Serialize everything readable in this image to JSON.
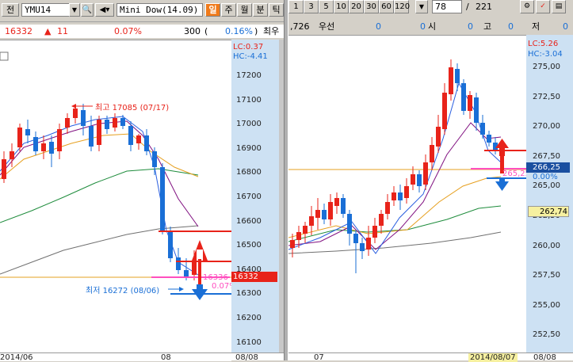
{
  "left_toolbar": {
    "menu_label": "전",
    "symbol": "YMU14",
    "name": "Mini Dow(14.09)",
    "period_active": "일",
    "periods": [
      "주",
      "월",
      "분",
      "틱"
    ]
  },
  "left_status": {
    "price": "16332",
    "change_arrow": "▲",
    "change": "11",
    "change_pct": "0.07%",
    "volume": "300",
    "paren": "(",
    "pct2": "0.16%",
    "paren2": ")",
    "tail": "최우"
  },
  "left_chart": {
    "lc_label": "LC:0.37",
    "hc_label": "HC:-4.41",
    "y_ticks": [
      "17200",
      "17100",
      "17000",
      "16900",
      "16800",
      "16700",
      "16600",
      "16500",
      "16400",
      "16300",
      "16200",
      "16100"
    ],
    "price_tag": "16332",
    "high_note": "최고 17085 (07/17)",
    "low_note": "최저 16272 (08/06)",
    "overlay_price": "16336",
    "overlay_pct": "0.07%",
    "x_labels": [
      "2014/06",
      "08",
      "08/08"
    ],
    "colors": {
      "up": "#e8231a",
      "down": "#1a6fd6",
      "ma5": "#2a5fe0",
      "ma10": "#801080",
      "ma20": "#e6a020",
      "ma60": "#1e8c3c",
      "ma120": "#707070"
    }
  },
  "right_toolbar": {
    "buttons": [
      "1",
      "3",
      "5",
      "10",
      "20",
      "30",
      "60",
      "120"
    ],
    "count": "78",
    "slash": "/",
    "total": "221"
  },
  "right_status": {
    "value": ",726",
    "label": "우선",
    "v1": "0",
    "v2": "0",
    "l2": "시",
    "v3": "0",
    "l3": "고",
    "v4": "0",
    "l4": "저",
    "v5": "0"
  },
  "right_chart": {
    "lc_label": "LC:5.26",
    "hc_label": "HC:-3.04",
    "y_ticks": [
      "275,00",
      "272,50",
      "270,00",
      "267,50",
      "265,00",
      "262,50",
      "260,00",
      "257,50",
      "255,00",
      "252,50"
    ],
    "price_tag": "266,25",
    "pct_tag": "0.00%",
    "last_tag": "262,74",
    "small_label": "265,25",
    "x_labels": [
      "07",
      "2014/08/07",
      "08/08"
    ]
  }
}
